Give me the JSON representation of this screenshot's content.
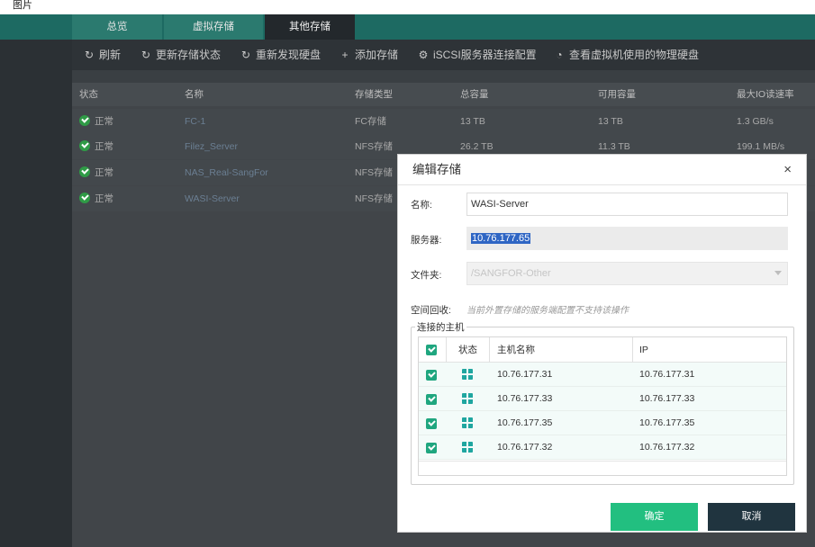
{
  "window": {
    "caption": "图片"
  },
  "tabs": [
    {
      "label": "总览"
    },
    {
      "label": "虚拟存储"
    },
    {
      "label": "其他存储"
    }
  ],
  "toolbar": [
    {
      "label": "刷新",
      "icon": "refresh-icon"
    },
    {
      "label": "更新存储状态",
      "icon": "refresh-icon"
    },
    {
      "label": "重新发现硬盘",
      "icon": "refresh-icon"
    },
    {
      "label": "添加存储",
      "icon": "plus-icon"
    },
    {
      "label": "iSCSI服务器连接配置",
      "icon": "gear-icon"
    },
    {
      "label": "查看虚拟机使用的物理硬盘",
      "icon": "pie-chart-icon"
    }
  ],
  "storage_table": {
    "columns": [
      "状态",
      "名称",
      "存储类型",
      "总容量",
      "可用容量",
      "最大IO读速率"
    ],
    "rows": [
      {
        "status": "正常",
        "name": "FC-1",
        "type": "FC存储",
        "total": "13 TB",
        "available": "13 TB",
        "max_io": "1.3 GB/s"
      },
      {
        "status": "正常",
        "name": "Filez_Server",
        "type": "NFS存储",
        "total": "26.2 TB",
        "available": "11.3 TB",
        "max_io": "199.1 MB/s"
      },
      {
        "status": "正常",
        "name": "NAS_Real-SangFor",
        "type": "NFS存储",
        "total": "",
        "available": "",
        "max_io": ""
      },
      {
        "status": "正常",
        "name": "WASI-Server",
        "type": "NFS存储",
        "total": "",
        "available": "",
        "max_io": ""
      }
    ]
  },
  "dialog": {
    "title": "编辑存储",
    "close": "×",
    "name_label": "名称:",
    "name_value": "WASI-Server",
    "server_label": "服务器:",
    "server_value": "10.76.177.65",
    "folder_label": "文件夹:",
    "folder_value": "/SANGFOR-Other",
    "reclaim_label": "空间回收:",
    "reclaim_hint": "当前外置存储的服务端配置不支持该操作",
    "hosts_group_label": "连接的主机",
    "hosts_columns": [
      "状态",
      "主机名称",
      "IP"
    ],
    "hosts": [
      {
        "name": "10.76.177.31",
        "ip": "10.76.177.31"
      },
      {
        "name": "10.76.177.33",
        "ip": "10.76.177.33"
      },
      {
        "name": "10.76.177.35",
        "ip": "10.76.177.35"
      },
      {
        "name": "10.76.177.32",
        "ip": "10.76.177.32"
      }
    ],
    "ok_label": "确定",
    "cancel_label": "取消"
  },
  "colors": {
    "accent": "#22bf80",
    "tab_bar": "#1d6a62",
    "cancel": "#20343f",
    "status_ok": "#2f9b46"
  }
}
